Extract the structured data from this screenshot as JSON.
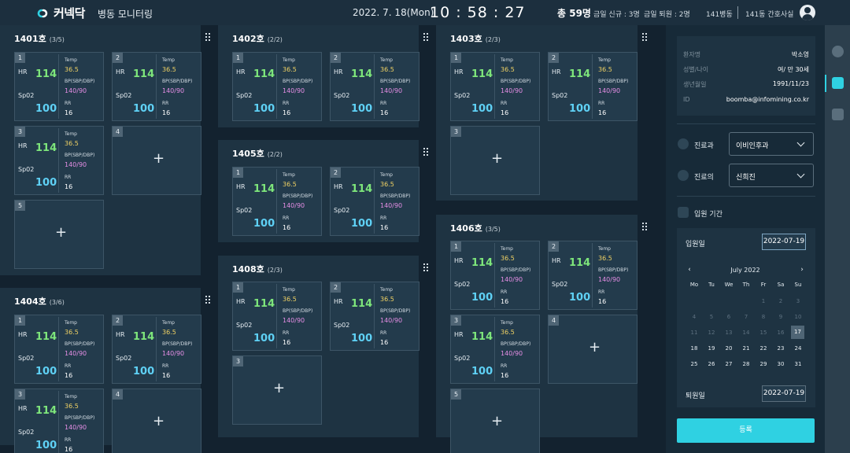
{
  "header": {
    "logo": "커넥닥",
    "title": "병동 모니터링",
    "date": "2022. 7. 18(Mon)",
    "clock": "10 : 58 : 27",
    "total": "총 59명",
    "admissions": "금일 신규 : 3명",
    "discharges": "금일 퇴원 : 2명",
    "ward": "141병동",
    "facility": "141동 간호사실"
  },
  "labels": {
    "hr": "HR",
    "spo2": "Sp02",
    "temp": "Temp",
    "bp": "BP(SBP/DBP)",
    "rr": "RR"
  },
  "rooms": [
    {
      "name": "1401호",
      "count": "(3/5)",
      "beds": [
        {
          "num": "1",
          "occupied": true,
          "hr": "114",
          "spo2": "100",
          "temp": "36.5",
          "bp": "140/90",
          "rr": "16"
        },
        {
          "num": "2",
          "occupied": true,
          "hr": "114",
          "spo2": "100",
          "temp": "36.5",
          "bp": "140/90",
          "rr": "16"
        },
        {
          "num": "3",
          "occupied": true,
          "hr": "114",
          "spo2": "100",
          "temp": "36.5",
          "bp": "140/90",
          "rr": "16"
        },
        {
          "num": "4",
          "occupied": false
        },
        {
          "num": "5",
          "occupied": false
        }
      ]
    },
    {
      "name": "1404호",
      "count": "(3/6)",
      "beds": [
        {
          "num": "1",
          "occupied": true,
          "hr": "114",
          "spo2": "100",
          "temp": "36.5",
          "bp": "140/90",
          "rr": "16"
        },
        {
          "num": "2",
          "occupied": true,
          "hr": "114",
          "spo2": "100",
          "temp": "36.5",
          "bp": "140/90",
          "rr": "16"
        },
        {
          "num": "3",
          "occupied": true,
          "hr": "114",
          "spo2": "100",
          "temp": "36.5",
          "bp": "140/90",
          "rr": "16"
        },
        {
          "num": "4",
          "occupied": false
        }
      ]
    },
    {
      "name": "1402호",
      "count": "(2/2)",
      "beds": [
        {
          "num": "1",
          "occupied": true,
          "hr": "114",
          "spo2": "100",
          "temp": "36.5",
          "bp": "140/90",
          "rr": "16"
        },
        {
          "num": "2",
          "occupied": true,
          "hr": "114",
          "spo2": "100",
          "temp": "36.5",
          "bp": "140/90",
          "rr": "16"
        }
      ]
    },
    {
      "name": "1405호",
      "count": "(2/2)",
      "beds": [
        {
          "num": "1",
          "occupied": true,
          "hr": "114",
          "spo2": "100",
          "temp": "36.5",
          "bp": "140/90",
          "rr": "16"
        },
        {
          "num": "2",
          "occupied": true,
          "hr": "114",
          "spo2": "100",
          "temp": "36.5",
          "bp": "140/90",
          "rr": "16"
        }
      ]
    },
    {
      "name": "1408호",
      "count": "(2/3)",
      "beds": [
        {
          "num": "1",
          "occupied": true,
          "hr": "114",
          "spo2": "100",
          "temp": "36.5",
          "bp": "140/90",
          "rr": "16"
        },
        {
          "num": "2",
          "occupied": true,
          "hr": "114",
          "spo2": "100",
          "temp": "36.5",
          "bp": "140/90",
          "rr": "16"
        },
        {
          "num": "3",
          "occupied": false
        }
      ]
    },
    {
      "name": "1403호",
      "count": "(2/3)",
      "beds": [
        {
          "num": "1",
          "occupied": true,
          "hr": "114",
          "spo2": "100",
          "temp": "36.5",
          "bp": "140/90",
          "rr": "16"
        },
        {
          "num": "2",
          "occupied": true,
          "hr": "114",
          "spo2": "100",
          "temp": "36.5",
          "bp": "140/90",
          "rr": "16"
        },
        {
          "num": "3",
          "occupied": false
        }
      ]
    },
    {
      "name": "1406호",
      "count": "(3/5)",
      "beds": [
        {
          "num": "1",
          "occupied": true,
          "hr": "114",
          "spo2": "100",
          "temp": "36.5",
          "bp": "140/90",
          "rr": "16"
        },
        {
          "num": "2",
          "occupied": true,
          "hr": "114",
          "spo2": "100",
          "temp": "36.5",
          "bp": "140/90",
          "rr": "16"
        },
        {
          "num": "3",
          "occupied": true,
          "hr": "114",
          "spo2": "100",
          "temp": "36.5",
          "bp": "140/90",
          "rr": "16"
        },
        {
          "num": "4",
          "occupied": false
        },
        {
          "num": "5",
          "occupied": false
        }
      ]
    }
  ],
  "patient": {
    "name_label": "환자명",
    "name": "박소영",
    "sex_age_label": "성별/나이",
    "sex_age": "여/ 만 30세",
    "dob_label": "생년월일",
    "dob": "1991/11/23",
    "id_label": "ID",
    "id": "boomba@infomining.co.kr"
  },
  "form": {
    "dept_label": "진료과",
    "dept_value": "이비인후과",
    "doctor_label": "진료의",
    "doctor_value": "신희진",
    "period_label": "입원 기간",
    "admit_label": "입원일",
    "admit_value": "2022-07-19",
    "discharge_label": "퇴원일",
    "discharge_value": "2022-07-19",
    "submit": "등록"
  },
  "calendar": {
    "title": "July 2022",
    "prev": "‹",
    "next": "›",
    "weekdays": [
      "Mo",
      "Tu",
      "We",
      "Th",
      "Fr",
      "Sa",
      "Su"
    ],
    "weeks": [
      [
        "",
        "",
        "",
        "",
        "1",
        "2",
        "3"
      ],
      [
        "4",
        "5",
        "6",
        "7",
        "8",
        "9",
        "10"
      ],
      [
        "11",
        "12",
        "13",
        "14",
        "15",
        "16",
        "17"
      ],
      [
        "18",
        "19",
        "20",
        "21",
        "22",
        "23",
        "24"
      ],
      [
        "25",
        "26",
        "27",
        "28",
        "29",
        "30",
        "31"
      ]
    ],
    "selected": "17",
    "first_active": "17"
  },
  "plus": "+"
}
